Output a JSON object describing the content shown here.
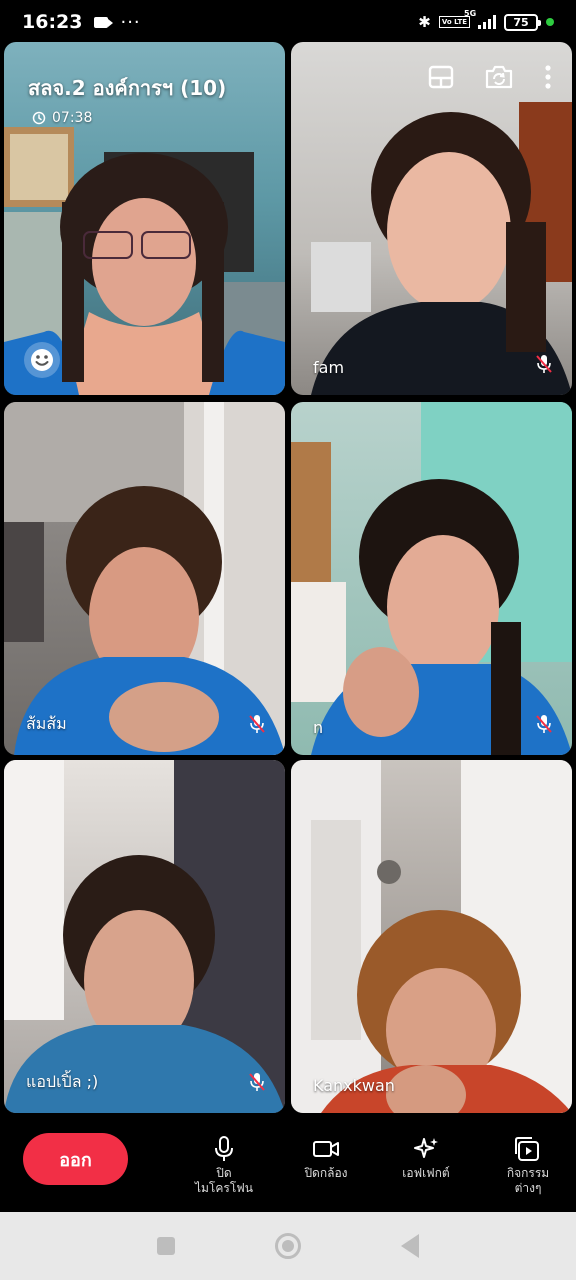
{
  "status": {
    "time": "16:23",
    "volte": "Vo LTE",
    "network": "5G",
    "battery": "75"
  },
  "meeting": {
    "title": "สลจ.2 องค์การฯ (10)",
    "duration": "07:38"
  },
  "participants": [
    {
      "name": "",
      "muted": false
    },
    {
      "name": "fam",
      "muted": true
    },
    {
      "name": "ส้มส้ม",
      "muted": true
    },
    {
      "name": "n",
      "muted": true
    },
    {
      "name": "แอปเปิ้ล ;)",
      "muted": true
    },
    {
      "name": "Kanxkwan",
      "muted": false
    }
  ],
  "controls": {
    "leave": "ออก",
    "mic": "ปิด\nไมโครโฟน",
    "camera": "ปิดกล้อง",
    "effects": "เอฟเฟกต์",
    "activities": "กิจกรรม\nต่างๆ"
  },
  "icons": {
    "status": [
      "video-call-icon",
      "more-icon",
      "bluetooth-icon",
      "signal-icon",
      "battery-icon"
    ],
    "header": [
      "layout-icon",
      "switch-camera-icon",
      "more-vertical-icon"
    ],
    "tile": [
      "mic-off-icon",
      "smiley-icon"
    ],
    "nav": [
      "recents-icon",
      "home-icon",
      "back-icon"
    ]
  },
  "colors": {
    "leave_button": "#f22f46",
    "nav_bar": "#e8e8e8"
  }
}
